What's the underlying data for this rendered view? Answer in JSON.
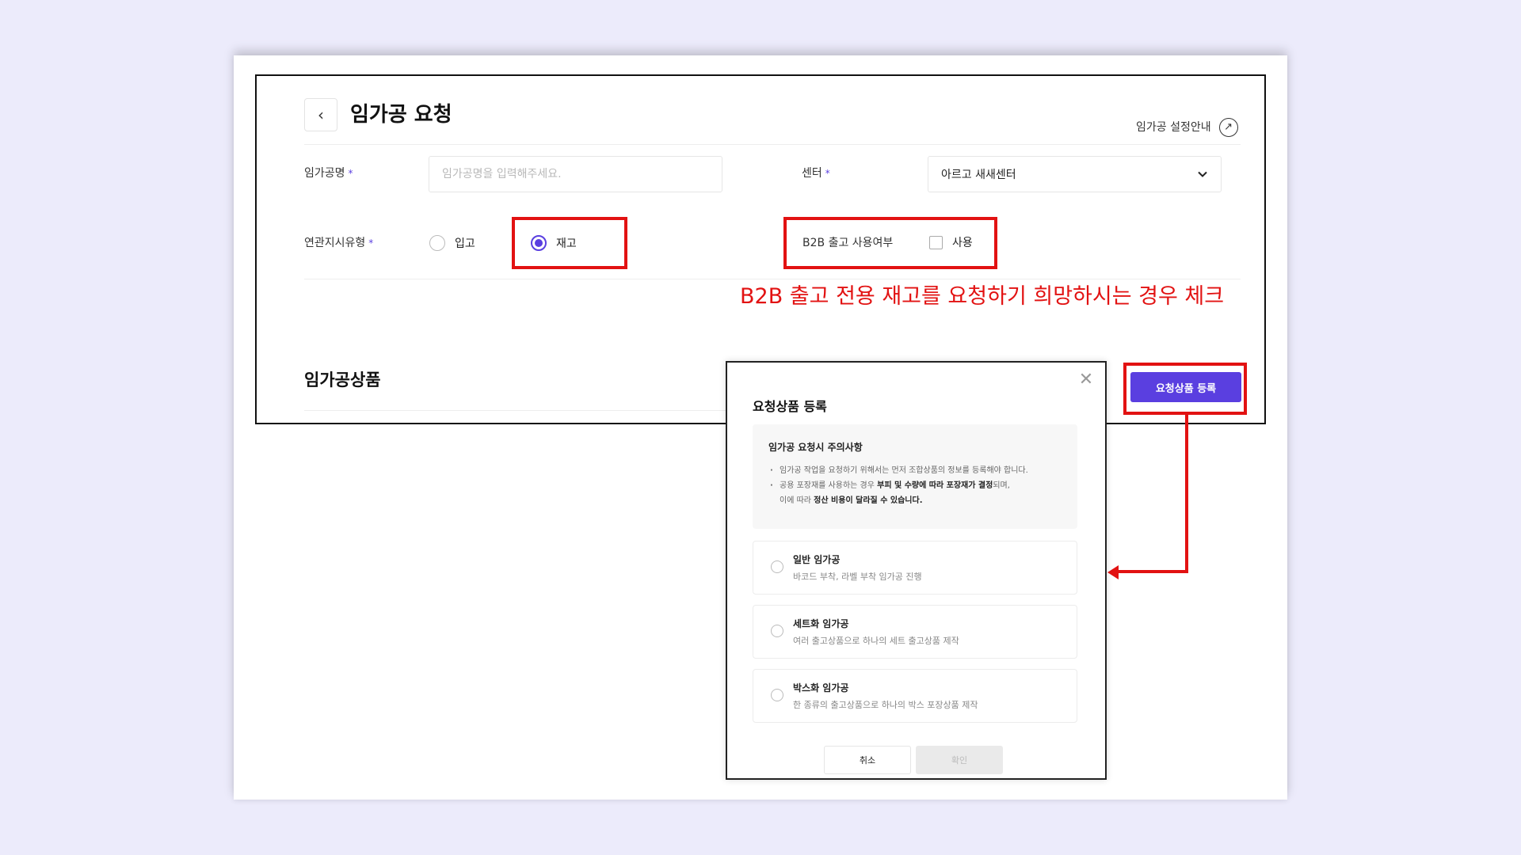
{
  "header": {
    "title": "임가공 요청",
    "back_icon": "chevron-left-icon",
    "guide_link": "임가공 설정안내",
    "guide_icon": "arrow-up-right-circle-icon"
  },
  "form": {
    "required_mark": "*",
    "name_label": "임가공명",
    "name_placeholder": "임가공명을 입력해주세요.",
    "name_value": "",
    "center_label": "센터",
    "center_value": "아르고 새새센터",
    "instruction_type_label": "연관지시유형",
    "instruction_options": [
      {
        "label": "입고",
        "checked": false
      },
      {
        "label": "재고",
        "checked": true
      }
    ],
    "b2b_label": "B2B 출고 사용여부",
    "b2b_checkbox_label": "사용",
    "b2b_checked": false
  },
  "annotation": {
    "text": "B2B 출고 전용 재고를 요청하기 희망하시는 경우 체크",
    "color": "#e21212"
  },
  "products_section": {
    "title": "임가공상품",
    "register_button": "요청상품 등록"
  },
  "modal": {
    "title": "요청상품 등록",
    "notice": {
      "title": "임가공 요청시 주의사항",
      "item1": "임가공 작업을 요청하기 위해서는 먼저 조합상품의 정보를 등록해야 합니다.",
      "item2_pre": "공용 포장재를 사용하는 경우 ",
      "item2_bold": "부피 및 수량에 따라 포장재가 결정",
      "item2_post": "되며,",
      "item2_cont_pre": "이에 따라 ",
      "item2_cont_bold": "정산 비용이 달라질 수 있습니다."
    },
    "options": [
      {
        "title": "일반 임가공",
        "desc": "바코드 부착, 라벨 부착 임가공 진행"
      },
      {
        "title": "세트화 임가공",
        "desc": "여러 출고상품으로 하나의 세트 출고상품 제작"
      },
      {
        "title": "박스화 임가공",
        "desc": "한 종류의 출고상품으로 하나의 박스 포장상품 제작"
      }
    ],
    "cancel_button": "취소",
    "confirm_button": "확인"
  },
  "colors": {
    "accent": "#5a3fe0",
    "highlight": "#e21212",
    "background": "#ecebfb"
  }
}
